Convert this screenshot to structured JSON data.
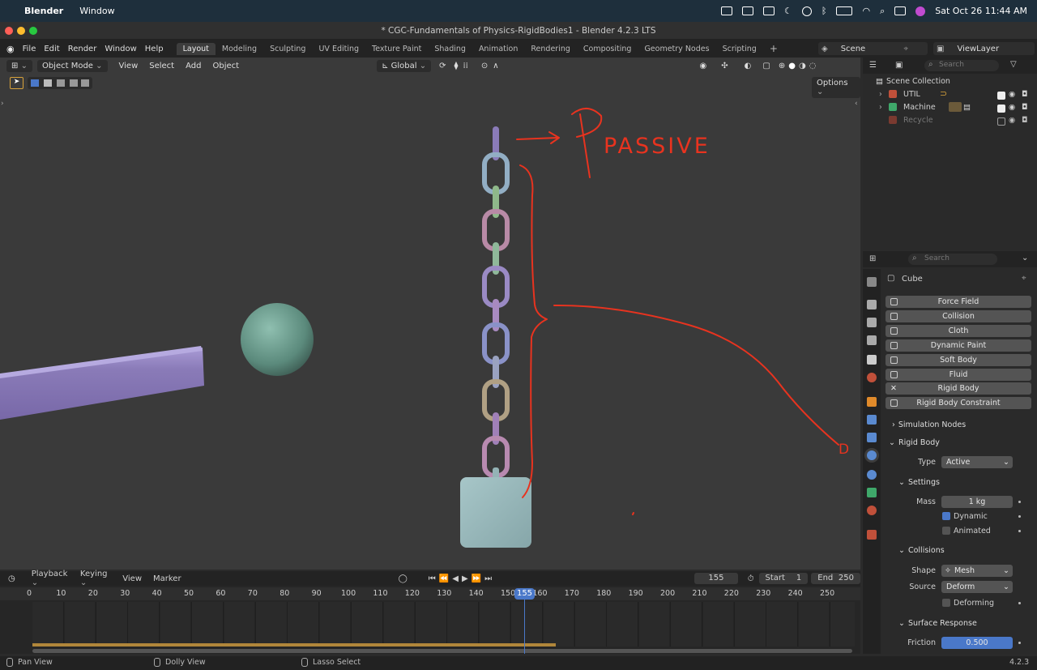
{
  "macbar": {
    "app_name": "Blender",
    "menu_window": "Window",
    "datetime": "Sat Oct 26  11:44 AM"
  },
  "window_title": "* CGC-Fundamentals of Physics-RigidBodies1 - Blender 4.2.3 LTS",
  "top_menu": [
    "File",
    "Edit",
    "Render",
    "Window",
    "Help"
  ],
  "workspaces": [
    "Layout",
    "Modeling",
    "Sculpting",
    "UV Editing",
    "Texture Paint",
    "Shading",
    "Animation",
    "Rendering",
    "Compositing",
    "Geometry Nodes",
    "Scripting"
  ],
  "active_workspace": "Layout",
  "scene_name": "Scene",
  "view_layer": "ViewLayer",
  "viewport_header": {
    "mode": "Object Mode",
    "menus": [
      "View",
      "Select",
      "Add",
      "Object"
    ],
    "orientation": "Global",
    "options_label": "Options"
  },
  "annotations": {
    "passive": "PASSIVE",
    "d_label": "D"
  },
  "outliner": {
    "search_placeholder": "Search",
    "root": "Scene Collection",
    "items": [
      {
        "name": "UTIL",
        "visible": true
      },
      {
        "name": "Machine",
        "visible": true
      },
      {
        "name": "Recycle",
        "visible": false
      }
    ]
  },
  "properties": {
    "search_placeholder": "Search",
    "object_name": "Cube",
    "physics_buttons": [
      "Force Field",
      "Collision",
      "Cloth",
      "Dynamic Paint",
      "Soft Body",
      "Fluid",
      "Rigid Body",
      "Rigid Body Constraint"
    ],
    "simulation_nodes": "Simulation Nodes",
    "rigid_body": {
      "header": "Rigid Body",
      "type_label": "Type",
      "type_value": "Active",
      "settings_header": "Settings",
      "mass_label": "Mass",
      "mass_value": "1 kg",
      "dynamic_label": "Dynamic",
      "animated_label": "Animated",
      "collisions_header": "Collisions",
      "shape_label": "Shape",
      "shape_value": "Mesh",
      "source_label": "Source",
      "source_value": "Deform",
      "deforming_label": "Deforming",
      "surface_header": "Surface Response",
      "friction_label": "Friction",
      "friction_value": "0.500"
    }
  },
  "timeline": {
    "menus": [
      "Playback",
      "Keying",
      "View",
      "Marker"
    ],
    "current_frame": "155",
    "start_label": "Start",
    "start_value": "1",
    "end_label": "End",
    "end_value": "250",
    "ruler": [
      "0",
      "10",
      "20",
      "30",
      "40",
      "50",
      "60",
      "70",
      "80",
      "90",
      "100",
      "110",
      "120",
      "130",
      "140",
      "150",
      "160",
      "170",
      "180",
      "190",
      "200",
      "210",
      "220",
      "230",
      "240",
      "250"
    ]
  },
  "statusbar": {
    "pan": "Pan View",
    "dolly": "Dolly View",
    "lasso": "Lasso Select",
    "version": "4.2.3"
  },
  "colors": {
    "accent": "#4a78c9",
    "annotation": "#e8331f",
    "sphere": "#6f9a8c",
    "beam": "#8a7bb8",
    "cube": "#94b3b6"
  }
}
